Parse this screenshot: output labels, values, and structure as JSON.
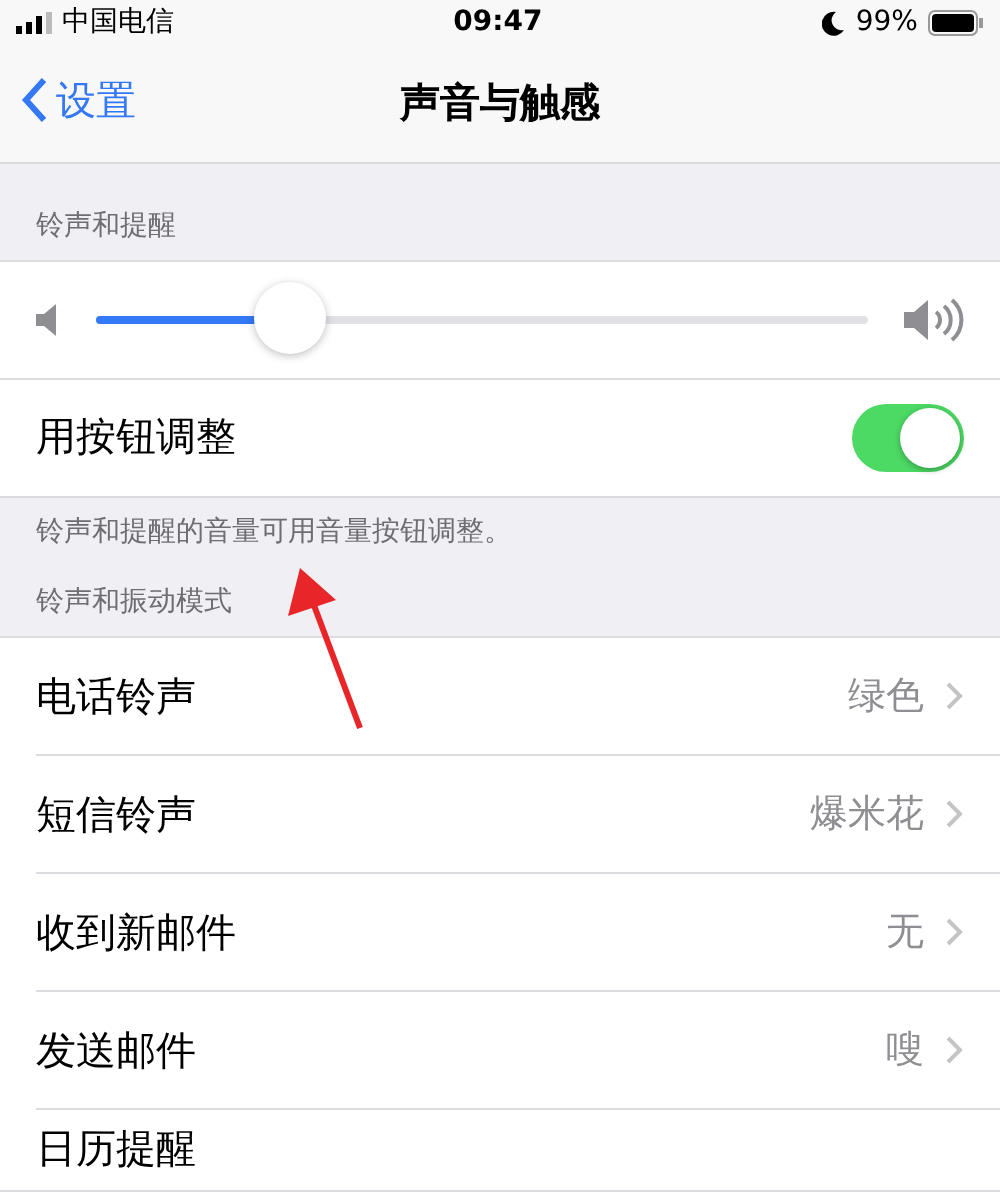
{
  "status_bar": {
    "carrier": "中国电信",
    "time": "09:47",
    "battery": "99%"
  },
  "nav": {
    "back": "设置",
    "title": "声音与触感"
  },
  "ringer_section": {
    "header": "铃声和提醒",
    "volume": {
      "level": 0.25
    },
    "toggle": {
      "label": "用按钮调整",
      "on": true
    },
    "footer": "铃声和提醒的音量可用音量按钮调整。"
  },
  "sound_section": {
    "header": "铃声和振动模式",
    "rows": [
      {
        "label": "电话铃声",
        "value": "绿色"
      },
      {
        "label": "短信铃声",
        "value": "爆米花"
      },
      {
        "label": "收到新邮件",
        "value": "无"
      },
      {
        "label": "发送邮件",
        "value": "嗖"
      },
      {
        "label": "日历提醒"
      }
    ]
  },
  "annotation": {
    "kind": "arrow"
  }
}
